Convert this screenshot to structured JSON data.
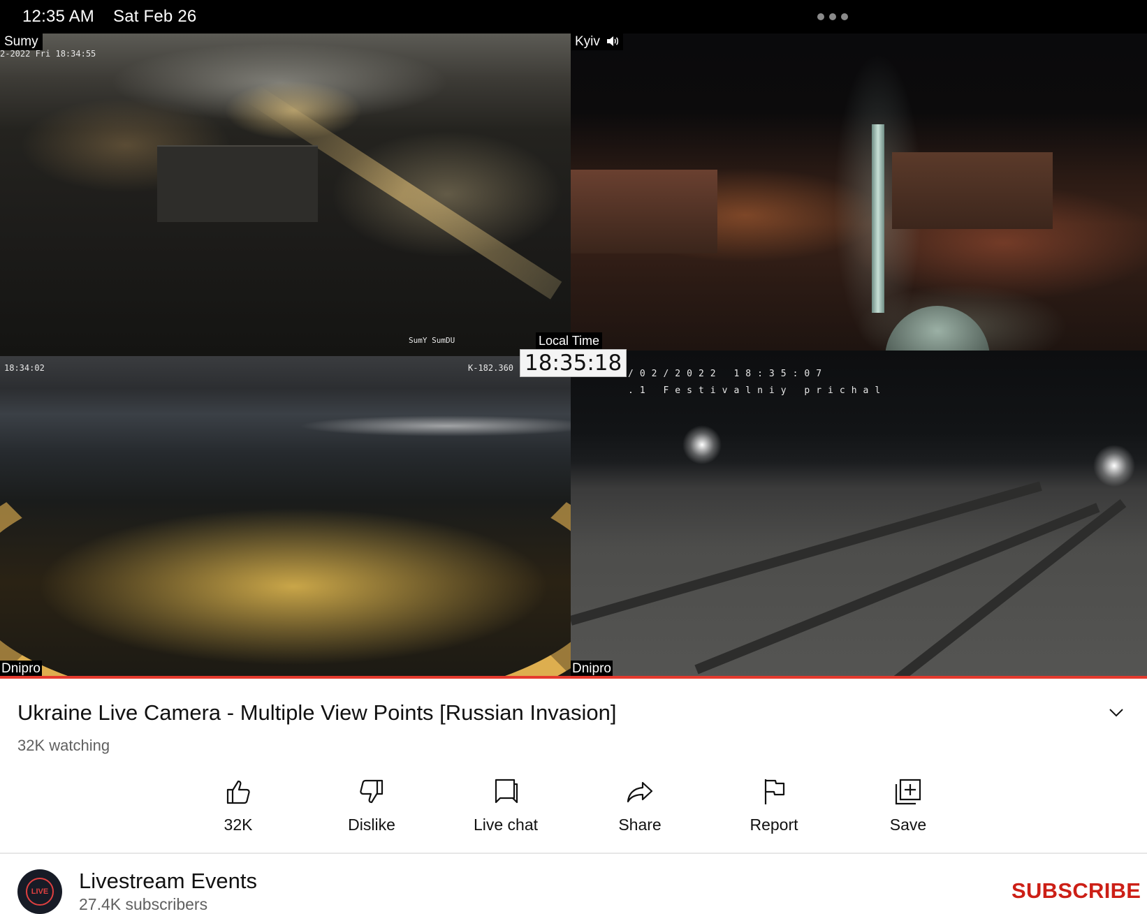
{
  "status_bar": {
    "time": "12:35 AM",
    "date": "Sat Feb 26"
  },
  "player": {
    "cameras": [
      {
        "label": "Sumy",
        "osd_top": "2-2022 Fri 18:34:55",
        "osd_watermark": "SumY SumDU"
      },
      {
        "label": "Kyiv",
        "audio_icon": "speaker-icon"
      },
      {
        "label": "Dnipro",
        "osd_time": "18:34:02",
        "osd_code": "K-182.360"
      },
      {
        "label": "Dnipro",
        "osd_line1": "/02/2022 18:35:07",
        "osd_line2": ".1 Festivalniy prichal"
      }
    ],
    "local_time_label": "Local Time",
    "local_time_value": "18:35:18",
    "progress_color": "#e53a2e"
  },
  "video": {
    "title": "Ukraine Live Camera - Multiple View Points [Russian Invasion]",
    "watching": "32K watching"
  },
  "actions": [
    {
      "icon": "thumbs-up-icon",
      "label": "32K"
    },
    {
      "icon": "thumbs-down-icon",
      "label": "Dislike"
    },
    {
      "icon": "live-chat-icon",
      "label": "Live chat"
    },
    {
      "icon": "share-icon",
      "label": "Share"
    },
    {
      "icon": "flag-icon",
      "label": "Report"
    },
    {
      "icon": "save-playlist-icon",
      "label": "Save"
    }
  ],
  "channel": {
    "name": "Livestream Events",
    "subscribers": "27.4K subscribers",
    "avatar_text": "LIVE",
    "subscribe_label": "SUBSCRIBE",
    "subscribe_color": "#cc1f16"
  }
}
